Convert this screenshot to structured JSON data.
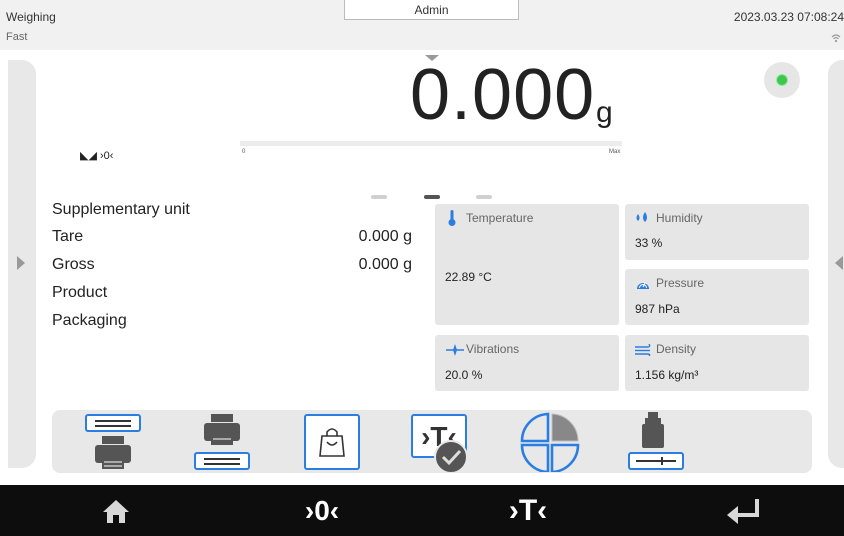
{
  "header": {
    "mode": "Weighing",
    "speed": "Fast",
    "user": "Admin",
    "datetime": "2023.03.23 07:08:24",
    "wifi_icon": "wifi-icon"
  },
  "display": {
    "value": "0.000",
    "unit": "g",
    "stability_symbols": "◣◢ ›0‹",
    "bar_min": "0",
    "bar_max": "Max",
    "bar_fill_fraction": 0,
    "status_color": "#3cc84a"
  },
  "info": {
    "rows": [
      {
        "label": "Supplementary unit",
        "value": ""
      },
      {
        "label": "Tare",
        "value": "0.000 g"
      },
      {
        "label": "Gross",
        "value": "0.000 g"
      },
      {
        "label": "Product",
        "value": ""
      },
      {
        "label": "Packaging",
        "value": ""
      }
    ]
  },
  "pager": {
    "count": 3,
    "active": 1
  },
  "tiles": {
    "temperature": {
      "title": "Temperature",
      "value": "22.89 °C"
    },
    "humidity": {
      "title": "Humidity",
      "value": "33 %"
    },
    "pressure": {
      "title": "Pressure",
      "value": "987 hPa"
    },
    "vibrations": {
      "title": "Vibrations",
      "value": "20.0 %"
    },
    "density": {
      "title": "Density",
      "value": "1.156 kg/m³"
    }
  },
  "quick_buttons": [
    "print-header-icon",
    "print-footer-icon",
    "packaging-icon",
    "tare-confirm-icon",
    "sectors-icon",
    "density-icon"
  ],
  "footer": {
    "home": "home-icon",
    "zero_label": "›0‹",
    "tare_label": "›T‹",
    "enter": "enter-icon"
  },
  "colors": {
    "accent": "#2a7de1",
    "footer": "#0d0d0d"
  }
}
